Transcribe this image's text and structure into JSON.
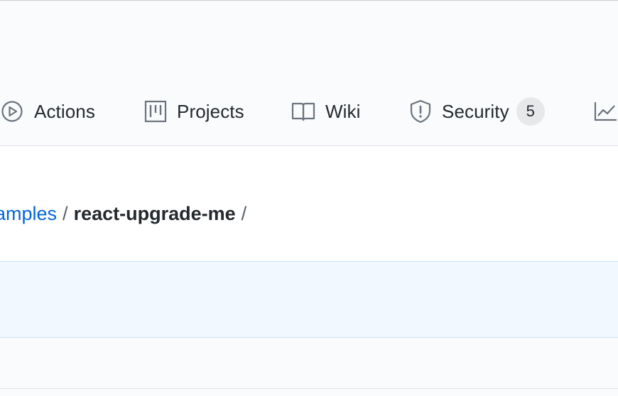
{
  "repo_nav": {
    "tabs": [
      {
        "label": "Actions",
        "icon": "play-circle-icon"
      },
      {
        "label": "Projects",
        "icon": "project-board-icon"
      },
      {
        "label": "Wiki",
        "icon": "book-icon"
      },
      {
        "label": "Security",
        "icon": "shield-icon",
        "count": "5"
      },
      {
        "label": "",
        "icon": "graph-icon"
      }
    ]
  },
  "breadcrumb": {
    "parent_link": "amples",
    "separator": "/",
    "current": "react-upgrade-me",
    "trailing_separator": "/"
  },
  "colors": {
    "link": "#0366d6",
    "text": "#24292e",
    "icon": "#6a737d",
    "info_bar": "#f1f8ff",
    "counter_bg": "#e6e8ea"
  }
}
